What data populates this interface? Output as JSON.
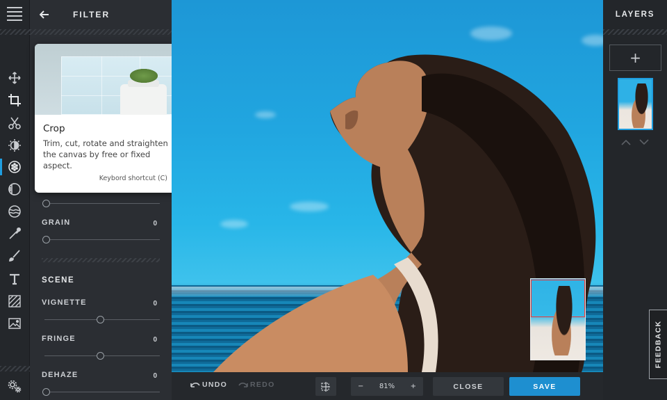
{
  "toolbar": {
    "tools": [
      {
        "name": "transform-icon"
      },
      {
        "name": "crop-icon"
      },
      {
        "name": "cutout-icon"
      },
      {
        "name": "adjust-icon"
      },
      {
        "name": "filter-icon"
      },
      {
        "name": "overlay-icon"
      },
      {
        "name": "liquify-icon"
      },
      {
        "name": "retouch-icon"
      },
      {
        "name": "draw-icon"
      },
      {
        "name": "text-icon"
      },
      {
        "name": "pattern-icon"
      },
      {
        "name": "image-icon"
      }
    ],
    "settings_icon": "settings-icon"
  },
  "panel": {
    "title": "FILTER",
    "sliders_top": [
      {
        "label": "GRAIN",
        "value": "0",
        "level": 0
      }
    ],
    "scene_title": "SCENE",
    "sliders_scene": [
      {
        "label": "VIGNETTE",
        "value": "0",
        "level": 0.5
      },
      {
        "label": "FRINGE",
        "value": "0",
        "level": 0.5
      },
      {
        "label": "DEHAZE",
        "value": "0",
        "level": 0
      }
    ]
  },
  "tooltip": {
    "title": "Crop",
    "description": "Trim, cut, rotate and straighten the canvas by free or fixed aspect.",
    "shortcut": "Keybord shortcut (C)"
  },
  "bottombar": {
    "undo": "UNDO",
    "redo": "REDO",
    "zoom_minus": "−",
    "zoom_value": "81%",
    "zoom_plus": "+",
    "close": "CLOSE",
    "save": "SAVE"
  },
  "layers": {
    "title": "LAYERS",
    "add": "+"
  },
  "feedback": "FEEDBACK",
  "colors": {
    "accent": "#1f9ee0",
    "save_button": "#1e8fd0",
    "panel": "#2b2e33"
  }
}
